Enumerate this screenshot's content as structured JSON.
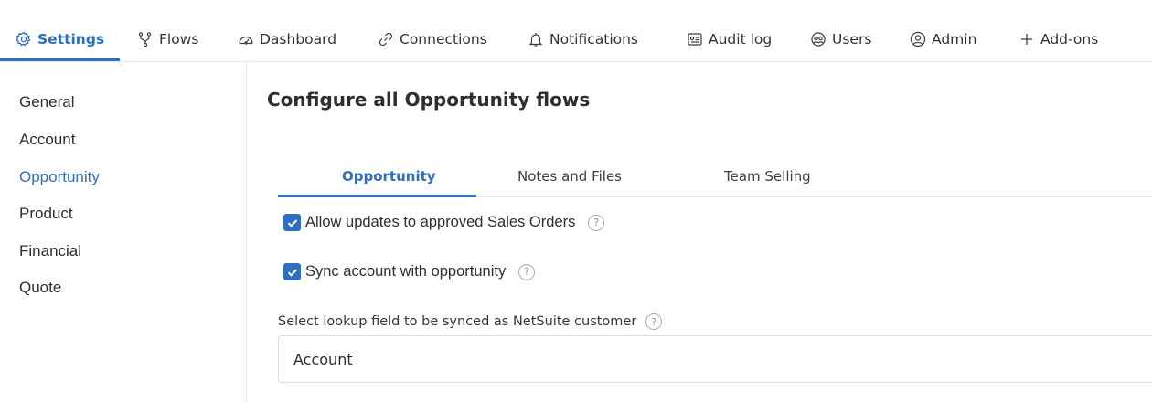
{
  "topnav": {
    "items": [
      {
        "label": "Settings",
        "icon": "gear-icon",
        "active": true
      },
      {
        "label": "Flows",
        "icon": "flows-icon"
      },
      {
        "label": "Dashboard",
        "icon": "gauge-icon"
      },
      {
        "label": "Connections",
        "icon": "link-icon"
      },
      {
        "label": "Notifications",
        "icon": "bell-icon"
      },
      {
        "label": "Audit log",
        "icon": "audit-log-icon"
      },
      {
        "label": "Users",
        "icon": "users-icon"
      },
      {
        "label": "Admin",
        "icon": "admin-icon"
      },
      {
        "label": "Add-ons",
        "icon": "plus-icon"
      }
    ]
  },
  "sidebar": {
    "items": [
      {
        "label": "General"
      },
      {
        "label": "Account"
      },
      {
        "label": "Opportunity",
        "active": true
      },
      {
        "label": "Product"
      },
      {
        "label": "Financial"
      },
      {
        "label": "Quote"
      }
    ]
  },
  "main": {
    "title": "Configure all Opportunity flows",
    "tabs": [
      {
        "label": "Opportunity",
        "active": true
      },
      {
        "label": "Notes and Files"
      },
      {
        "label": "Team Selling"
      }
    ],
    "options": [
      {
        "label": "Allow updates to approved Sales Orders",
        "checked": true,
        "help": "?"
      },
      {
        "label": "Sync account with opportunity",
        "checked": true,
        "help": "?"
      }
    ],
    "lookup": {
      "label": "Select lookup field to be synced as NetSuite customer",
      "help": "?",
      "value": "Account"
    }
  },
  "colors": {
    "accent": "#2f6fc0",
    "text": "#2b2f33",
    "border": "#e6e9ec"
  }
}
